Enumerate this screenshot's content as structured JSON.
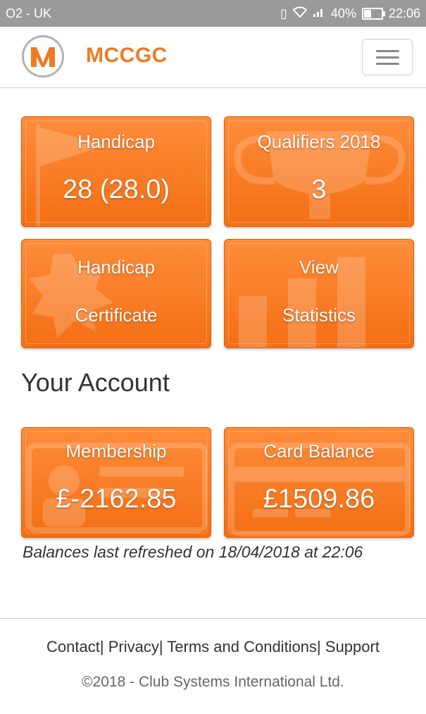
{
  "status_bar": {
    "carrier": "O2 - UK",
    "battery": "40%",
    "battery_level": 0.4,
    "time": "22:06"
  },
  "navbar": {
    "brand": "MCCGC",
    "logo_letter": "M",
    "brand_color": "#f07a22",
    "menu_icon": "hamburger-icon"
  },
  "tiles": {
    "handicap": {
      "label": "Handicap",
      "value": "28 (28.0)",
      "bg_icon": "golf-flag-icon"
    },
    "qualifiers": {
      "label": "Qualifiers 2018",
      "value": "3",
      "bg_icon": "trophy-icon"
    },
    "certificate": {
      "line1": "Handicap",
      "line2": "Certificate",
      "bg_icon": "rosette-icon"
    },
    "statistics": {
      "line1": "View",
      "line2": "Statistics",
      "bg_icon": "bar-chart-icon"
    }
  },
  "account": {
    "title": "Your Account",
    "membership": {
      "label": "Membership",
      "value": "£-2162.85",
      "bg_icon": "id-card-icon"
    },
    "card_balance": {
      "label": "Card Balance",
      "value": "£1509.86",
      "bg_icon": "credit-card-icon"
    },
    "refreshed": "Balances last refreshed on 18/04/2018 at 22:06"
  },
  "footer": {
    "links": [
      "Contact",
      "Privacy",
      "Terms and Conditions",
      "Support"
    ],
    "copyright": "©2018 - Club Systems International Ltd."
  },
  "colors": {
    "tile": "#f57a20",
    "tile_border": "#e36000"
  }
}
